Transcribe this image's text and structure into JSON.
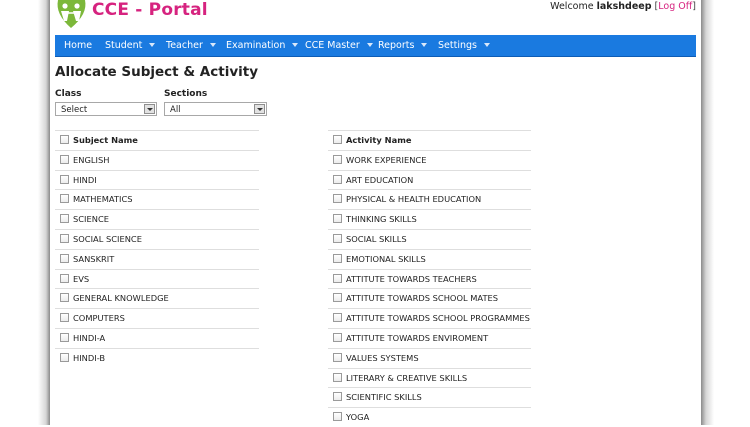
{
  "header": {
    "app_title": "CCE - Portal",
    "welcome_prefix": "Welcome",
    "username": "lakshdeep",
    "bracket_open": "[",
    "logoff_label": "Log Off",
    "bracket_close": "]"
  },
  "nav": {
    "items": [
      {
        "label": "Home",
        "dropdown": false
      },
      {
        "label": "Student",
        "dropdown": true
      },
      {
        "label": "Teacher",
        "dropdown": true
      },
      {
        "label": "Examination",
        "dropdown": true
      },
      {
        "label": "CCE Master",
        "dropdown": true
      },
      {
        "label": "Reports",
        "dropdown": true
      },
      {
        "label": "Settings",
        "dropdown": true
      }
    ]
  },
  "main": {
    "title": "Allocate Subject & Activity",
    "filters": {
      "class_label": "Class",
      "class_value": "Select",
      "sections_label": "Sections",
      "sections_value": "All"
    },
    "subjects": {
      "header": "Subject Name",
      "items": [
        "ENGLISH",
        "HINDI",
        "MATHEMATICS",
        "SCIENCE",
        "SOCIAL SCIENCE",
        "SANSKRIT",
        "EVS",
        "GENERAL KNOWLEDGE",
        "COMPUTERS",
        "HINDI-A",
        "HINDI-B"
      ]
    },
    "activities": {
      "header": "Activity Name",
      "items": [
        "WORK EXPERIENCE",
        "ART EDUCATION",
        "PHYSICAL & HEALTH EDUCATION",
        "THINKING SKILLS",
        "SOCIAL SKILLS",
        "EMOTIONAL SKILLS",
        "ATTITUTE TOWARDS TEACHERS",
        "ATTITUTE TOWARDS SCHOOL MATES",
        "ATTITUTE TOWARDS SCHOOL PROGRAMMES",
        "ATTITUTE TOWARDS ENVIROMENT",
        "VALUES SYSTEMS",
        "LITERARY & CREATIVE SKILLS",
        "SCIENTIFIC SKILLS",
        "YOGA"
      ]
    }
  },
  "colors": {
    "brand": "#d6237f",
    "nav_bg": "#1a7ae0",
    "logo_green": "#7cb83a"
  },
  "icons": {
    "logo": "people-logo-icon",
    "nav_caret": "caret-down-icon",
    "select_arrow": "dropdown-arrow-icon",
    "checkbox": "checkbox-icon"
  }
}
